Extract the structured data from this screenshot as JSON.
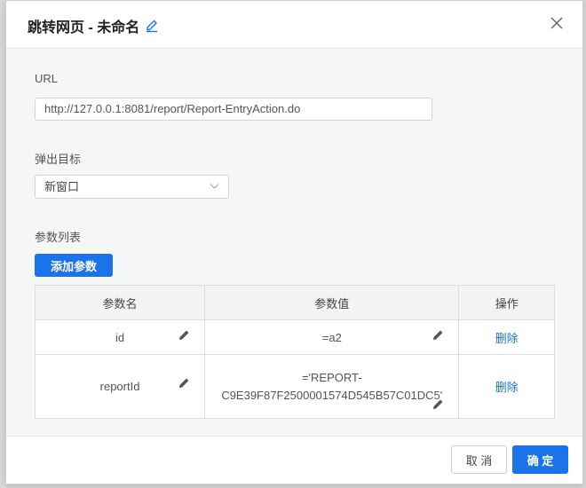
{
  "dialog": {
    "title": "跳转网页 - 未命名"
  },
  "url": {
    "label": "URL",
    "value": "http://127.0.0.1:8081/report/Report-EntryAction.do"
  },
  "target": {
    "label": "弹出目标",
    "selected": "新窗口"
  },
  "params": {
    "label": "参数列表",
    "add_button": "添加参数",
    "headers": [
      "参数名",
      "参数值",
      "操作"
    ],
    "rows": [
      {
        "name": "id",
        "value": "=a2",
        "action": "删除"
      },
      {
        "name": "reportId",
        "value_line1": "='REPORT-",
        "value_line2": "C9E39F87F2500001574D545B57C01DC5'",
        "action": "删除"
      }
    ]
  },
  "footer": {
    "cancel": "取 消",
    "ok": "确 定"
  },
  "colors": {
    "accent": "#1a73e8",
    "body_bg": "#f5f6f8"
  }
}
